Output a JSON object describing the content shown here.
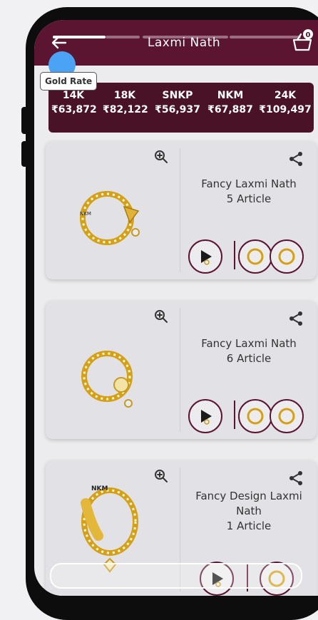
{
  "header": {
    "title": "Laxmi  Nath",
    "cart_count": "0",
    "icons": {
      "back": "arrow-left-icon",
      "cart": "basket-icon"
    },
    "colors": {
      "bar": "#5b1530",
      "rates_bg": "#4a1227"
    }
  },
  "gold_rate": {
    "label": "Gold Rate",
    "rates": [
      {
        "name": "14K",
        "value": "₹63,872"
      },
      {
        "name": "18K",
        "value": "₹82,122"
      },
      {
        "name": "SNKP",
        "value": "₹56,937"
      },
      {
        "name": "NKM",
        "value": "₹67,887"
      },
      {
        "name": "24K",
        "value": "₹109,497"
      }
    ]
  },
  "products": [
    {
      "title": "Fancy Laxmi Nath",
      "articles": "5 Article",
      "image_label": "NKM"
    },
    {
      "title": "Fancy Laxmi Nath",
      "articles": "6 Article",
      "image_label": ""
    },
    {
      "title": "Fancy Design Laxmi Nath",
      "articles": "1 Article",
      "image_label": "NKM"
    }
  ],
  "card_icons": {
    "zoom": "zoom-in-icon",
    "share": "share-icon",
    "play": "play-icon"
  }
}
